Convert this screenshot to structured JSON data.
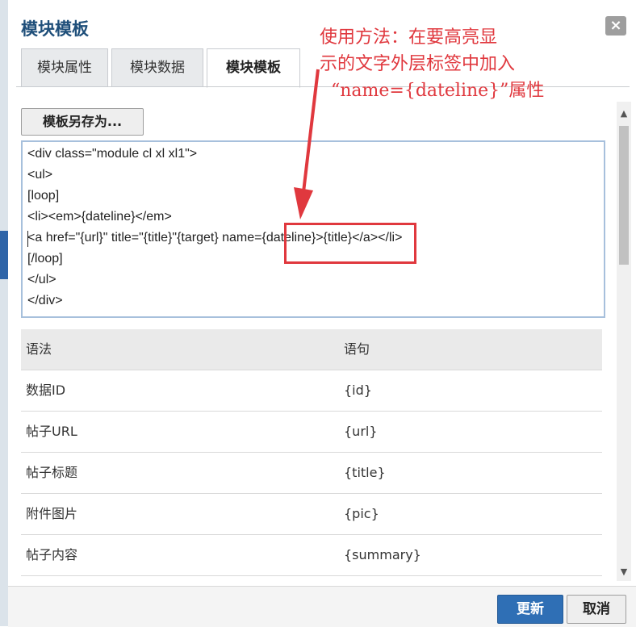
{
  "dialog": {
    "title": "模块模板",
    "close_label": "×"
  },
  "tabs": [
    {
      "label": "模块属性",
      "active": false
    },
    {
      "label": "模块数据",
      "active": false
    },
    {
      "label": "模块模板",
      "active": true
    }
  ],
  "toolbar": {
    "save_as_label": "模板另存为..."
  },
  "editor": {
    "lines": [
      "<div class=\"module cl xl xl1\">",
      "<ul>",
      "[loop]",
      "<li><em>{dateline}</em>",
      "<a href=\"{url}\" title=\"{title}\"{target} name={dateline}>{title}</a></li>",
      "[/loop]",
      "</ul>",
      "</div>"
    ]
  },
  "syntax_table": {
    "headers": [
      "语法",
      "语句"
    ],
    "rows": [
      [
        "数据ID",
        "{id}"
      ],
      [
        "帖子URL",
        "{url}"
      ],
      [
        "帖子标题",
        "{title}"
      ],
      [
        "附件图片",
        "{pic}"
      ],
      [
        "帖子内容",
        "{summary}"
      ]
    ]
  },
  "footer": {
    "update_label": "更新",
    "cancel_label": "取消"
  },
  "annotation": {
    "lines": [
      "使用方法：在要高亮显",
      "示的文字外层标签中加入",
      "“name={dateline}”属性"
    ],
    "color": "#e0383e"
  },
  "colors": {
    "title": "#1f4f7a",
    "primary_button": "#2f6fb5",
    "editor_border": "#a7c0dc"
  }
}
